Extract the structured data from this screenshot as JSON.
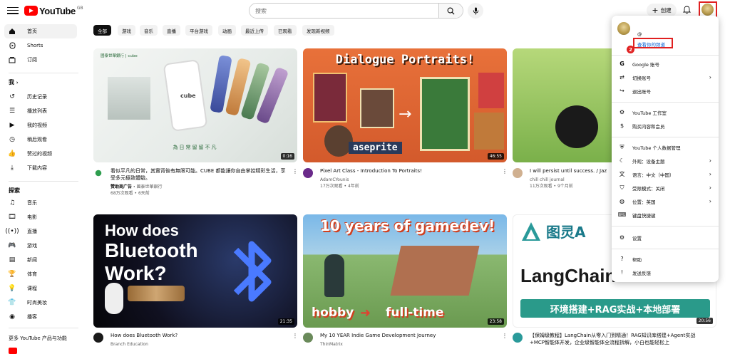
{
  "header": {
    "logo_text": "YouTube",
    "logo_country": "GB",
    "search_placeholder": "搜索",
    "create_label": "创建"
  },
  "sidebar": {
    "items_top": [
      {
        "label": "首页",
        "icon": "home-icon"
      },
      {
        "label": "Shorts",
        "icon": "shorts-icon"
      },
      {
        "label": "订阅",
        "icon": "subscriptions-icon"
      }
    ],
    "you_heading": "我",
    "you_items": [
      {
        "label": "历史记录",
        "icon": "history-icon"
      },
      {
        "label": "播放列表",
        "icon": "playlists-icon"
      },
      {
        "label": "我的视频",
        "icon": "your-videos-icon"
      },
      {
        "label": "稍后观看",
        "icon": "watch-later-icon"
      },
      {
        "label": "赞过的视频",
        "icon": "liked-videos-icon"
      },
      {
        "label": "下载内容",
        "icon": "downloads-icon"
      }
    ],
    "explore_heading": "探索",
    "explore_items": [
      {
        "label": "音乐",
        "icon": "music-icon"
      },
      {
        "label": "电影",
        "icon": "movies-icon"
      },
      {
        "label": "直播",
        "icon": "live-icon"
      },
      {
        "label": "游戏",
        "icon": "gaming-icon"
      },
      {
        "label": "新闻",
        "icon": "news-icon"
      },
      {
        "label": "体育",
        "icon": "sports-icon"
      },
      {
        "label": "课程",
        "icon": "courses-icon"
      },
      {
        "label": "时尚美妆",
        "icon": "fashion-icon"
      },
      {
        "label": "播客",
        "icon": "podcasts-icon"
      }
    ],
    "more_heading": "更多 YouTube 产品与功能"
  },
  "chips": [
    "全部",
    "游戏",
    "音乐",
    "直播",
    "平台游戏",
    "动画",
    "最近上传",
    "已观看",
    "发现新视频"
  ],
  "videos": [
    {
      "title": "看似平凡的日常，其實背後有無限可能。CUBE 都能讓你自由掌控精彩生活，享受多元極致體驗。",
      "channel": "國泰世華銀行",
      "sponsored": "赞助商广告 · ",
      "meta": "68万次观看 • 6天前",
      "duration": "0:16"
    },
    {
      "title": "Pixel Art Class - Introduction To Portraits!",
      "channel": "AdamCYounis",
      "meta": "17万次观看 • 4年前",
      "duration": "46:55"
    },
    {
      "title": "I will persist until success. / Jaz",
      "channel": "chill chill journal",
      "meta": "11万次观看 • 9个月前",
      "duration": ""
    },
    {
      "title": "How does Bluetooth Work?",
      "channel": "Branch Education",
      "meta": "",
      "duration": "21:35"
    },
    {
      "title": "My 10 YEAR Indie Game Development Journey",
      "channel": "ThinMatrix",
      "meta": "",
      "duration": "23:58"
    },
    {
      "title": "【保姆级教程】LangChain从零入门到精通！RAG知识库搭建+Agent实战+MCP智能体开发，企业级智能体全流程拆解，小白也能轻松上",
      "channel": "",
      "meta": "",
      "duration": "20:56"
    }
  ],
  "thumb_text": {
    "cube_top": "國泰世華銀行 | cube",
    "cube_sub": "為日常留留不凡",
    "cube_word": "cube",
    "pixel_title": "Dialogue Portraits!",
    "pixel_tag": "aseprite",
    "bt_line1": "How does",
    "bt_line2": "Bluetooth",
    "bt_line3": "Work?",
    "game_title": "10 years of gamedev!",
    "game_hobby": "hobby",
    "game_full": "full-time",
    "lc_brand": "图灵A",
    "lc_title": "LangChain",
    "lc_sub": "环境搭建+RAG实战+本地部署"
  },
  "account_menu": {
    "handle": "@",
    "view_channel": "查看你的频道",
    "items": [
      {
        "label": "Google 账号",
        "icon": "google-icon",
        "arrow": false
      },
      {
        "label": "切换账号",
        "icon": "switch-account-icon",
        "arrow": true
      },
      {
        "label": "退出账号",
        "icon": "sign-out-icon",
        "arrow": false
      },
      {
        "label": "YouTube 工作室",
        "icon": "studio-icon",
        "arrow": false
      },
      {
        "label": "购买内容和会员",
        "icon": "purchases-icon",
        "arrow": false
      },
      {
        "label": "YouTube 个人数据管理",
        "icon": "data-icon",
        "arrow": false
      },
      {
        "label": "外观：设备主题",
        "icon": "appearance-icon",
        "arrow": true
      },
      {
        "label": "语言：中文（中国）",
        "icon": "language-icon",
        "arrow": true
      },
      {
        "label": "受限模式：关闭",
        "icon": "restricted-icon",
        "arrow": true
      },
      {
        "label": "位置：英国",
        "icon": "location-icon",
        "arrow": true
      },
      {
        "label": "键盘快捷键",
        "icon": "keyboard-icon",
        "arrow": false
      },
      {
        "label": "设置",
        "icon": "settings-icon",
        "arrow": false
      },
      {
        "label": "帮助",
        "icon": "help-icon",
        "arrow": false
      },
      {
        "label": "发送反馈",
        "icon": "feedback-icon",
        "arrow": false
      }
    ]
  },
  "annotations": {
    "step1": "1",
    "step2": "2"
  }
}
